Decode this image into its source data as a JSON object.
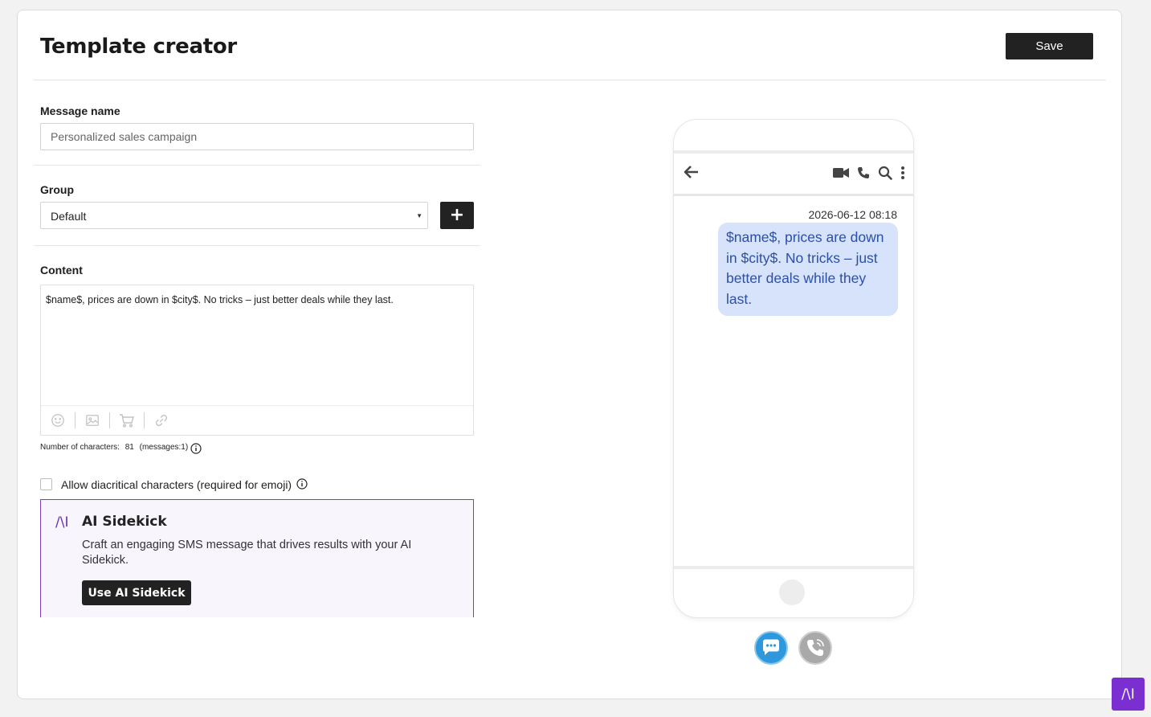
{
  "header": {
    "title": "Template creator",
    "save_label": "Save"
  },
  "form": {
    "message_name": {
      "label": "Message name",
      "placeholder": "Personalized sales campaign",
      "value": ""
    },
    "group": {
      "label": "Group",
      "selected": "Default",
      "add_icon": "plus-icon"
    },
    "content": {
      "label": "Content",
      "text": "$name$, prices are down in $city$. No tricks – just better deals while they last.",
      "toolbar_icons": [
        "emoji-icon",
        "image-icon",
        "cart-icon",
        "link-icon"
      ]
    },
    "char_count": {
      "label": "Number of characters:",
      "count": "81",
      "messages": "(messages:1)"
    },
    "diacritics": {
      "label": "Allow diacritical characters (required for emoji)",
      "checked": false
    }
  },
  "ai_sidekick": {
    "logo": "/\\I",
    "title": "AI Sidekick",
    "description": "Craft an engaging SMS message that drives results with your AI Sidekick.",
    "button_label": "Use AI Sidekick"
  },
  "preview": {
    "timestamp": "2026-06-12 08:18",
    "message": "$name$, prices are down in $city$. No tricks – just better deals while they last.",
    "top_bar_icons": [
      "back-arrow-icon",
      "video-icon",
      "phone-icon",
      "search-icon",
      "more-vertical-icon"
    ],
    "modes": [
      "sms-mode-icon",
      "call-mode-icon"
    ],
    "bubble_color": "#d6e3fa",
    "bubble_text_color": "#2c4fa8"
  },
  "floating": {
    "ai_label": "/\\I",
    "color": "#7b2fd0"
  }
}
